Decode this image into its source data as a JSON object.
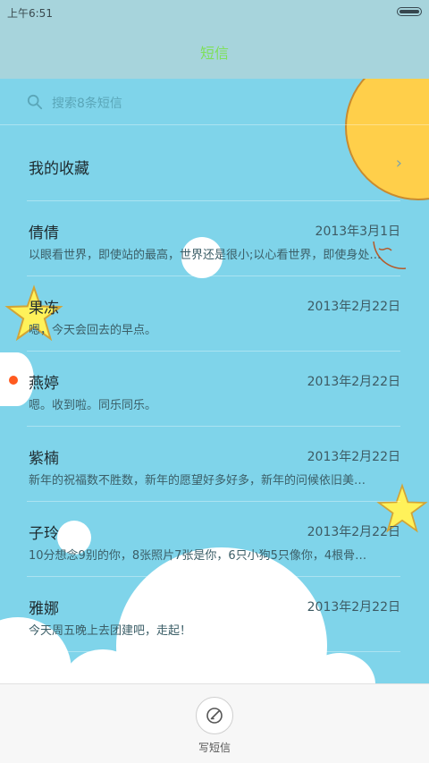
{
  "status": {
    "time": "上午6:51"
  },
  "header": {
    "title": "短信"
  },
  "search": {
    "placeholder": "搜索8条短信"
  },
  "favorites": {
    "label": "我的收藏",
    "chevron": "›"
  },
  "messages": [
    {
      "name": "倩倩",
      "date": "2013年3月1日",
      "preview": "以眼看世界，即使站的最高，世界还是很小;以心看世界，即使身处…",
      "unread": false
    },
    {
      "name": "果冻",
      "date": "2013年2月22日",
      "preview": "嗯，今天会回去的早点。",
      "unread": false
    },
    {
      "name": "燕婷",
      "date": "2013年2月22日",
      "preview": "嗯。收到啦。同乐同乐。",
      "unread": true
    },
    {
      "name": "紫楠",
      "date": "2013年2月22日",
      "preview": "新年的祝福数不胜数，新年的愿望好多好多，新年的问候依旧美…",
      "unread": false
    },
    {
      "name": "子玲",
      "date": "2013年2月22日",
      "preview": "10分想念9别的你，8张照片7张是你，6只小狗5只像你，4根骨…",
      "unread": false
    },
    {
      "name": "雅娜",
      "date": "2013年2月22日",
      "preview": "今天周五晚上去团建吧，走起！",
      "unread": false
    }
  ],
  "bottom": {
    "compose_label": "写短信"
  },
  "icons": {
    "search": "search-icon",
    "compose": "compose-icon",
    "battery": "battery-icon",
    "chevron": "chevron-right-icon"
  },
  "colors": {
    "background": "#7fd4ea",
    "topbar": "#a7d4dc",
    "title": "#7fe05a",
    "unread_dot": "#ff5a1f",
    "sun": "#ffcf4a",
    "star": "#fff25a"
  }
}
